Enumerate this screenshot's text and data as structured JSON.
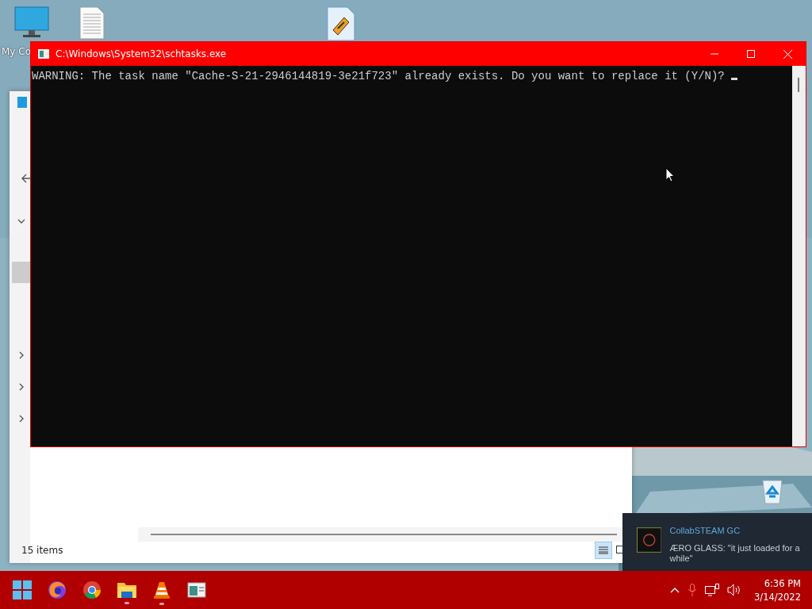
{
  "desktop_icons": [
    {
      "kind": "computer",
      "label": "My Co"
    },
    {
      "kind": "document"
    },
    {
      "kind": "media-file"
    }
  ],
  "explorer": {
    "status": "15 items"
  },
  "console": {
    "title": "C:\\Windows\\System32\\schtasks.exe",
    "output": "WARNING: The task name \"Cache-S-21-2946144819-3e21f723\" already exists. Do you want to replace it (Y/N)? "
  },
  "notification": {
    "app": "CollabSTEAM GC",
    "message": "ÆRO GLASS: \"it just loaded for a while\""
  },
  "taskbar": {
    "apps": [
      {
        "kind": "start",
        "running": false
      },
      {
        "kind": "firefox",
        "running": false
      },
      {
        "kind": "chrome",
        "running": false
      },
      {
        "kind": "folder",
        "running": true
      },
      {
        "kind": "vlc",
        "running": true
      },
      {
        "kind": "window",
        "running": false
      }
    ],
    "time": "6:36 PM",
    "date": "3/14/2022"
  }
}
